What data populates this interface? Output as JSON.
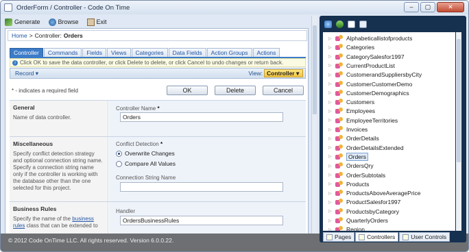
{
  "window": {
    "title": "OrderForm / Controller - Code On Time",
    "min": "–",
    "max": "▢",
    "close": "✕"
  },
  "toolbar": {
    "generate": "Generate",
    "browse": "Browse",
    "exit": "Exit"
  },
  "breadcrumb": {
    "home": "Home",
    "separator": ">",
    "label": "Controller:",
    "current": "Orders"
  },
  "tabs": [
    "Controller",
    "Commands",
    "Fields",
    "Views",
    "Categories",
    "Data Fields",
    "Action Groups",
    "Actions"
  ],
  "info": "Click OK to save the data controller, or click Delete to delete, or click Cancel to undo changes or return back.",
  "actionbar": {
    "record": "Record ▾",
    "view_label": "View:",
    "view_value": "Controller"
  },
  "required_note": "* - indicates a required field",
  "buttons": {
    "ok": "OK",
    "delete": "Delete",
    "cancel": "Cancel"
  },
  "sections": {
    "general": {
      "title": "General",
      "desc": "Name of data controller.",
      "field_label": "Controller Name",
      "field_value": "Orders"
    },
    "misc": {
      "title": "Miscellaneous",
      "desc": "Specify conflict detection strategy and optional connection string name. Specify a connection string name only if the controller is working with the database other than the one selected for this project.",
      "conflict_label": "Conflict Detection",
      "opt1": "Overwrite Changes",
      "opt2": "Compare All Values",
      "conn_label": "Connection String Name",
      "conn_value": ""
    },
    "rules": {
      "title": "Business Rules",
      "desc_pre": "Specify the name of the",
      "desc_link": "business rules",
      "desc_post": "class that can be extended to",
      "handler_label": "Handler",
      "handler_value": "OrdersBusinessRules"
    }
  },
  "required_star": "*",
  "status": "© 2012 Code OnTime LLC. All rights reserved. Version 6.0.0.22.",
  "tree": {
    "items": [
      "Alphabeticallistofproducts",
      "Categories",
      "CategorySalesfor1997",
      "CurrentProductList",
      "CustomerandSuppliersbyCity",
      "CustomerCustomerDemo",
      "CustomerDemographics",
      "Customers",
      "Employees",
      "EmployeeTerritories",
      "Invoices",
      "OrderDetails",
      "OrderDetailsExtended",
      "Orders",
      "OrdersQry",
      "OrderSubtotals",
      "Products",
      "ProductsAboveAveragePrice",
      "ProductSalesfor1997",
      "ProductsbyCategory",
      "QuarterlyOrders",
      "Region"
    ],
    "selected": "Orders",
    "expander": "▷"
  },
  "right_tabs": [
    "Pages",
    "Controllers",
    "User Controls"
  ]
}
